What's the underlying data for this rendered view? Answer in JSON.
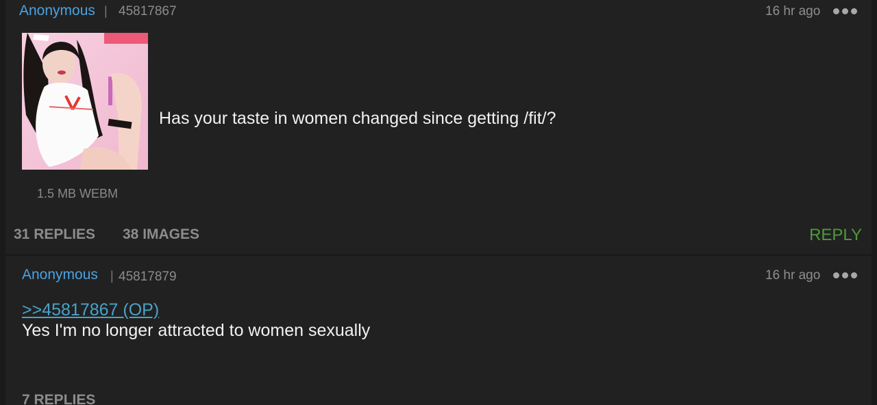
{
  "op": {
    "name": "Anonymous",
    "separator": "|",
    "post_id": "45817867",
    "time": "16 hr ago",
    "body": "Has your taste in women changed since getting /fit/?",
    "file_info": "1.5 MB WEBM",
    "replies_label": "31 REPLIES",
    "images_label": "38 IMAGES",
    "reply_button": "REPLY",
    "more_icon": "more-options-icon"
  },
  "reply": {
    "name": "Anonymous",
    "separator": "|",
    "post_id": "45817879",
    "time": "16 hr ago",
    "quote": ">>45817867 (OP)",
    "body": "Yes I'm no longer attracted to women sexually",
    "replies_label": "7 REPLIES",
    "more_icon": "more-options-icon"
  },
  "colors": {
    "background": "#1a1a1a",
    "card": "#212121",
    "name": "#4aa3e0",
    "reply_button": "#4e9a3b",
    "quote_link": "#4aa3c8",
    "body_text": "#f2f2f2",
    "muted_text": "#8c8c8c"
  }
}
